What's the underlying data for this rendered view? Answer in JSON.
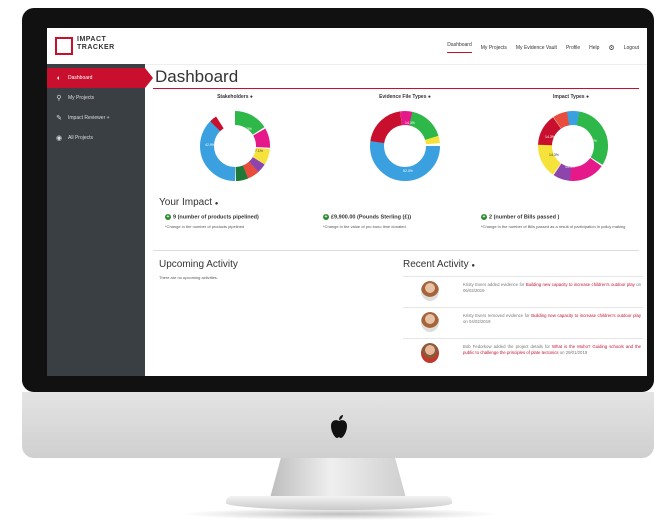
{
  "brand": {
    "line1": "IMPACT",
    "line2": "TRACKER",
    "accent": "#c8102e"
  },
  "nav": {
    "dashboard": "Dashboard",
    "projects": "My Projects",
    "vault": "My Evidence Vault",
    "profile": "Profile",
    "help": "Help",
    "logout": "Logout"
  },
  "sidebar": {
    "items": [
      {
        "label": "Dashboard",
        "icon": "dashboard-icon"
      },
      {
        "label": "My Projects",
        "icon": "map-pin-icon"
      },
      {
        "label": "Impact Reviewer +",
        "icon": "megaphone-icon"
      },
      {
        "label": "All Projects",
        "icon": "globe-icon"
      }
    ]
  },
  "page": {
    "title": "Dashboard"
  },
  "charts": [
    {
      "title": "Stakeholders",
      "labels": [
        "14.3%",
        "7.1%",
        "42.9%"
      ]
    },
    {
      "title": "Evidence File Types",
      "labels": [
        "14.3%",
        "52.0%"
      ]
    },
    {
      "title": "Impact Types",
      "labels": [
        "21.4%",
        "14.3%",
        "14.3%",
        "14.3%"
      ]
    }
  ],
  "impact": {
    "title": "Your Impact",
    "items": [
      {
        "value": "9 (number of products pipelined)",
        "note": "*Change in the number of products pipelined"
      },
      {
        "value": "£9,900.00 (Pounds Sterling (£))",
        "note": "*Change in the value of pro bono time donated"
      },
      {
        "value": "2 (number of Bills passed )",
        "note": "*Change in the number of Bills passed as a result of participation in policy making"
      }
    ]
  },
  "upcoming": {
    "title": "Upcoming Activity",
    "empty": "There are no upcoming activities."
  },
  "recent": {
    "title": "Recent Activity",
    "items": [
      {
        "pre": "Kristy Evers added evidence for ",
        "link": "Building new capacity to increase children's outdoor play",
        "post": " on 06/02/2019"
      },
      {
        "pre": "Kristy Evers removed evidence for ",
        "link": "Building new capacity to increase children's outdoor play",
        "post": " on 04/02/2019"
      },
      {
        "pre": "Bob Fedorkow added the project details for ",
        "link": "What is the Moho? Guiding schools and the public to challenge the principles of plate tectonics",
        "post": " on 29/01/2019"
      }
    ]
  }
}
